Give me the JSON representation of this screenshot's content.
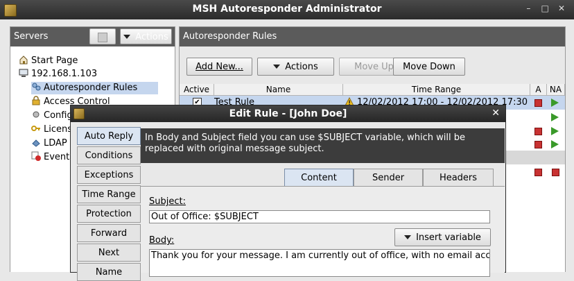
{
  "window": {
    "title": "MSH Autoresponder Administrator",
    "controls": [
      "–",
      "□",
      "✕"
    ]
  },
  "servers_panel": {
    "title": "Servers",
    "actions_label": "Actions",
    "tree": [
      {
        "label": "Start Page",
        "icon": "house-icon"
      },
      {
        "label": "192.168.1.103",
        "icon": "computer-icon"
      },
      {
        "label": "Autoresponder Rules",
        "icon": "users-icon",
        "selected": true
      },
      {
        "label": "Access Control",
        "icon": "lock-icon"
      },
      {
        "label": "Config",
        "icon": "config-icon"
      },
      {
        "label": "Licens",
        "icon": "key-icon"
      },
      {
        "label": "LDAP D",
        "icon": "ldap-icon"
      },
      {
        "label": "Events",
        "icon": "events-icon"
      }
    ]
  },
  "rules_panel": {
    "title": "Autoresponder Rules",
    "buttons": {
      "add_new": "Add New...",
      "actions": "Actions",
      "move_up": "Move Up",
      "move_down": "Move Down"
    },
    "columns": [
      "Active",
      "Name",
      "Time Range",
      "A",
      "NA"
    ],
    "rows": [
      {
        "active": true,
        "name": "Test Rule",
        "time_range": "12/02/2012 17:00 - 12/02/2012 17:30",
        "warning": true
      }
    ]
  },
  "dialog": {
    "title": "Edit Rule - [John Doe]",
    "close": "✕",
    "side_tabs": [
      "Auto Reply",
      "Conditions",
      "Exceptions",
      "Time Range",
      "Protection",
      "Forward",
      "Next",
      "Name"
    ],
    "info_text": "In Body and Subject field you can use $SUBJECT variable, which will be replaced with original message subject.",
    "tabs": [
      "Content",
      "Sender",
      "Headers"
    ],
    "subject_label": "Subject:",
    "subject_value": "Out of Office: $SUBJECT",
    "insert_variable": "Insert variable",
    "body_label": "Body:",
    "body_value": "Thank you for your message. I am currently out of office, with no email access."
  },
  "colors": {
    "header_bg": "#5b5b5b",
    "selection": "#c5d6ee",
    "info_bg": "#3c3c3c"
  }
}
